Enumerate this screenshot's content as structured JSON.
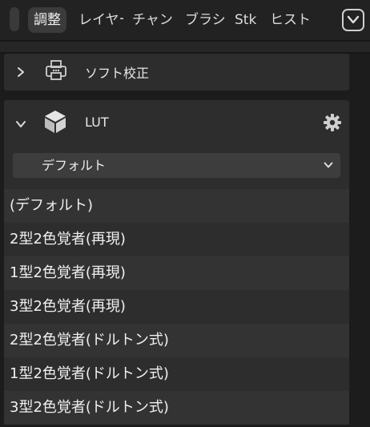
{
  "tabs": [
    {
      "label": "調整",
      "active": true
    },
    {
      "label": "レイヤー"
    },
    {
      "label": "チャンネル"
    },
    {
      "label": "ブラシ"
    },
    {
      "label": "Stk"
    },
    {
      "label": "ヒストリー"
    }
  ],
  "icons": {
    "tab_more": "chevron-down-icon",
    "soft_proof": "printer-icon",
    "lut": "cube-icon",
    "settings": "gear-icon"
  },
  "panels": {
    "soft_proof": {
      "title": "ソフト校正",
      "expanded": false
    },
    "lut": {
      "title": "LUT",
      "expanded": true,
      "dropdown_value": "デフォルト",
      "options": [
        "(デフォルト)",
        "2型2色覚者(再現)",
        "1型2色覚者(再現)",
        "3型2色覚者(再現)",
        "2型2色覚者(ドルトン式)",
        "1型2色覚者(ドルトン式)",
        "3型2色覚者(ドルトン式)"
      ]
    }
  },
  "colors": {
    "background": "#1c1c1c",
    "panel": "#2d2d2d",
    "panel_alt_row": "#333333",
    "control": "#3d3d3d",
    "text": "#f0f0f0",
    "icon": "#d0d0d0"
  }
}
